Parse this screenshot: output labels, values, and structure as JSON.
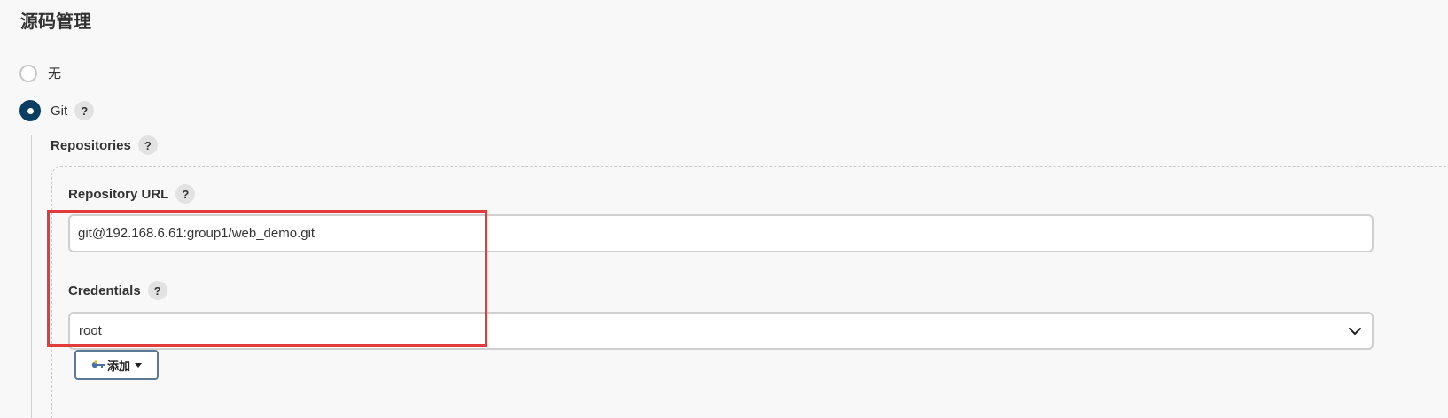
{
  "section": {
    "title": "源码管理"
  },
  "scm_options": [
    {
      "label": "无",
      "selected": false
    },
    {
      "label": "Git",
      "selected": true,
      "help": "?"
    }
  ],
  "repositories": {
    "label": "Repositories",
    "help": "?",
    "url": {
      "label": "Repository URL",
      "help": "?",
      "value": "git@192.168.6.61:group1/web_demo.git"
    },
    "credentials": {
      "label": "Credentials",
      "help": "?",
      "selected": "root"
    },
    "add_button": {
      "label": "添加"
    }
  },
  "colors": {
    "radio_selected": "#0a3e61",
    "highlight": "#e23b3b",
    "background": "#f8f8f8"
  },
  "icons": {
    "help": "question-circle-icon",
    "key": "key-icon",
    "dropdown": "chevron-down-icon",
    "caret": "caret-down-icon"
  }
}
